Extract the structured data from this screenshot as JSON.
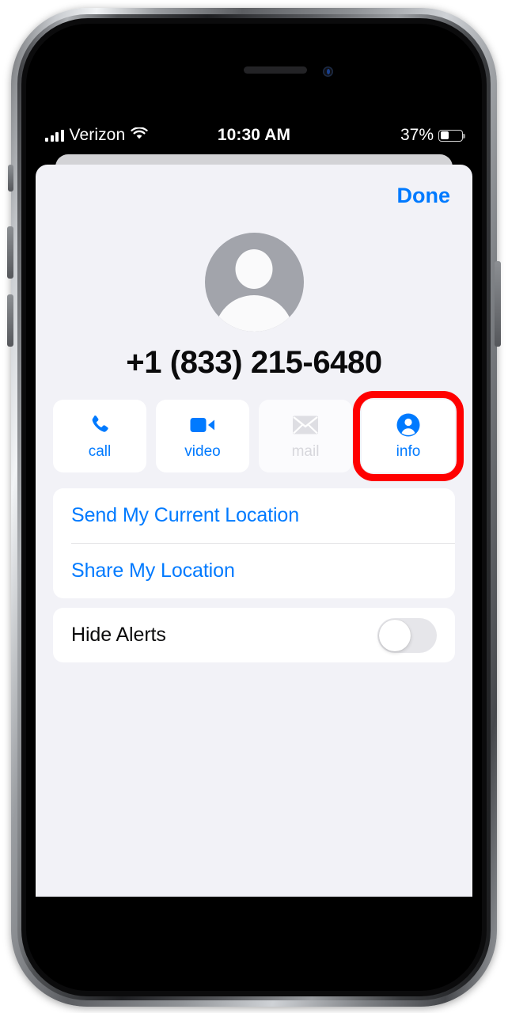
{
  "device": {
    "name": "iphone",
    "speaker_icon": "speaker-grill",
    "camera_icon": "front-camera"
  },
  "status_bar": {
    "signal_icon": "cellular-signal-icon",
    "carrier": "Verizon",
    "wifi_icon": "wifi-icon",
    "time": "10:30 AM",
    "battery_percent": "37%",
    "battery_icon": "battery-icon",
    "battery_level": 37
  },
  "sheet": {
    "done_label": "Done",
    "avatar_icon": "default-contact-avatar",
    "contact_name": "+1 (833) 215-6480",
    "actions": [
      {
        "id": "call",
        "label": "call",
        "icon": "phone-icon",
        "enabled": true,
        "highlighted": false
      },
      {
        "id": "video",
        "label": "video",
        "icon": "video-camera-icon",
        "enabled": true,
        "highlighted": false
      },
      {
        "id": "mail",
        "label": "mail",
        "icon": "envelope-icon",
        "enabled": false,
        "highlighted": false
      },
      {
        "id": "info",
        "label": "info",
        "icon": "person-circle-icon",
        "enabled": true,
        "highlighted": true
      }
    ],
    "list": [
      {
        "label": "Send My Current Location",
        "style": "link"
      },
      {
        "label": "Share My Location",
        "style": "link"
      }
    ],
    "toggle_row": {
      "label": "Hide Alerts",
      "state": "off"
    }
  },
  "colors": {
    "accent_blue": "#007aff",
    "highlight_red": "#ff0000",
    "sheet_bg": "#f2f2f7",
    "card_bg": "#ffffff",
    "disabled_grey": "#d7d7dc"
  }
}
